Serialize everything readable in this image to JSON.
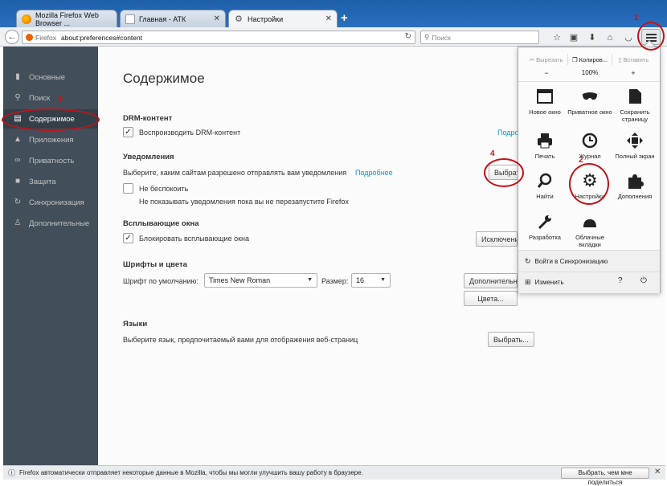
{
  "tabs": [
    {
      "label": "Mozilla Firefox Web Browser ...",
      "icon": "firefox-icon"
    },
    {
      "label": "Главная - АТК",
      "icon": "page-icon"
    },
    {
      "label": "Настройки",
      "icon": "gear-icon"
    }
  ],
  "navbar": {
    "identity": "Firefox",
    "url": "about:preferences#content",
    "search_placeholder": "Поиск"
  },
  "sidebar": {
    "items": [
      {
        "label": "Основные",
        "icon": "general-icon"
      },
      {
        "label": "Поиск",
        "icon": "search-icon"
      },
      {
        "label": "Содержимое",
        "icon": "content-icon"
      },
      {
        "label": "Приложения",
        "icon": "applications-icon"
      },
      {
        "label": "Приватность",
        "icon": "privacy-mask-icon"
      },
      {
        "label": "Защита",
        "icon": "security-lock-icon"
      },
      {
        "label": "Синхронизация",
        "icon": "sync-icon"
      },
      {
        "label": "Дополнительные",
        "icon": "advanced-icon"
      }
    ]
  },
  "content": {
    "title": "Содержимое",
    "drm": {
      "title": "DRM-контент",
      "checkbox_label": "Воспроизводить DRM-контент",
      "link": "Подро"
    },
    "notifications": {
      "title": "Уведомления",
      "description": "Выберите, каким сайтам разрешено отправлять вам уведомления",
      "link": "Подробнее",
      "button": "Выбрать...",
      "dnd_label": "Не беспокоить",
      "dnd_description": "Не показывать уведомления пока вы не перезапустите Firefox"
    },
    "popups": {
      "title": "Всплывающие окна",
      "checkbox_label": "Блокировать всплывающие окна",
      "button": "Исключения..."
    },
    "fonts": {
      "title": "Шрифты и цвета",
      "default_font_label": "Шрифт по умолчанию:",
      "default_font_value": "Times New Roman",
      "size_label": "Размер:",
      "size_value": "16",
      "advanced_button": "Дополнительно...",
      "colors_button": "Цвета..."
    },
    "languages": {
      "title": "Языки",
      "description": "Выберите язык, предпочитаемый вами для отображения веб-страниц",
      "button": "Выбрать..."
    }
  },
  "menu_panel": {
    "cut": "Вырезать",
    "copy": "Копиров...",
    "paste": "Вставить",
    "zoom_out": "−",
    "zoom_level": "100%",
    "zoom_in": "+",
    "items": [
      {
        "label": "Новое окно",
        "icon": "new-window-icon"
      },
      {
        "label": "Приватное окно",
        "icon": "private-mask-icon"
      },
      {
        "label": "Сохранить страницу",
        "icon": "save-page-icon"
      },
      {
        "label": "Печать",
        "icon": "print-icon"
      },
      {
        "label": "Журнал",
        "icon": "history-clock-icon"
      },
      {
        "label": "Полный экран",
        "icon": "fullscreen-icon"
      },
      {
        "label": "Найти",
        "icon": "find-magnifier-icon"
      },
      {
        "label": "Настройки",
        "icon": "settings-gear-icon"
      },
      {
        "label": "Дополнения",
        "icon": "addons-puzzle-icon"
      },
      {
        "label": "Разработка",
        "icon": "developer-wrench-icon"
      },
      {
        "label": "Облачные вкладки",
        "icon": "synced-tabs-icon"
      }
    ],
    "sync_label": "Войти в Синхронизацию",
    "customize_label": "Изменить"
  },
  "statusbar": {
    "message": "Firefox автоматически отправляет некоторые данные в Mozilla, чтобы мы могли улучшить вашу работу в браузере.",
    "button": "Выбрать, чем мне поделиться"
  },
  "annotations": {
    "n1": "1",
    "n2": "2",
    "n3": "3",
    "n4": "4"
  },
  "colors": {
    "sidebar": "#424f5a",
    "annotation": "#c0141a",
    "link": "#0096dd"
  }
}
